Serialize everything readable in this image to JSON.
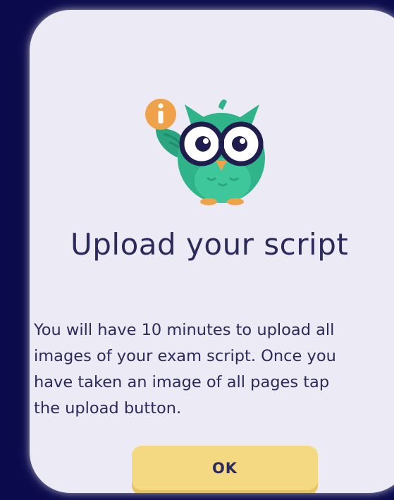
{
  "dialog": {
    "title": "Upload your script",
    "message": "You will have 10 minutes to upload all\nimages of your exam script. Once you\nhave taken an image of all pages tap\nthe upload button.",
    "ok_label": "OK"
  },
  "mascot": {
    "icon": "owl-mascot-icon",
    "badge_icon": "info-icon",
    "badge_glyph": "i"
  },
  "colors": {
    "backdrop": "#0b0a4c",
    "dialog_bg": "#eceaf4",
    "text": "#2c2a5c",
    "button": "#f5d982",
    "badge": "#f0a24a",
    "owl_body": "#2fb389"
  }
}
